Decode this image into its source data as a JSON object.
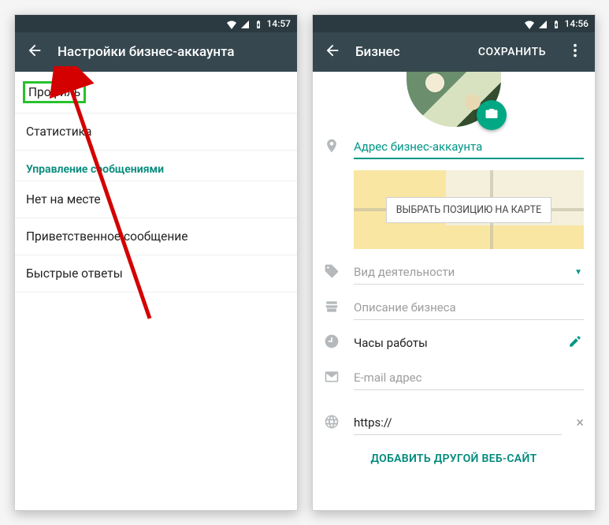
{
  "left": {
    "status_time": "14:57",
    "title": "Настройки бизнес-аккаунта",
    "items": {
      "profile": "Профиль",
      "stats": "Статистика",
      "section": "Управление сообщениями",
      "away": "Нет на месте",
      "greeting": "Приветственное сообщение",
      "quick": "Быстрые ответы"
    }
  },
  "right": {
    "status_time": "14:56",
    "title": "Бизнес",
    "save": "СОХРАНИТЬ",
    "address_placeholder": "Адрес бизнес-аккаунта",
    "map_button": "ВЫБРАТЬ ПОЗИЦИЮ НА КАРТЕ",
    "category_placeholder": "Вид деятельности",
    "description_placeholder": "Описание бизнеса",
    "hours_label": "Часы работы",
    "email_placeholder": "E-mail адрес",
    "website_value": "https://",
    "add_site": "ДОБАВИТЬ ДРУГОЙ ВЕБ-САЙТ"
  }
}
